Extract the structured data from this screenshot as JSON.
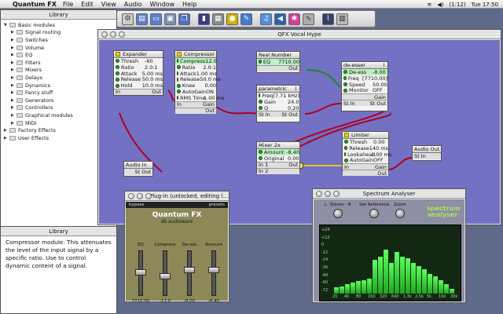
{
  "menubar": {
    "app": "Quantum FX",
    "items": [
      "File",
      "Edit",
      "View",
      "Audio",
      "Window",
      "Help"
    ],
    "battery": "(1:12)",
    "clock": "Tue 17:50"
  },
  "library": {
    "title": "Library",
    "root": "Basic modules",
    "items": [
      "Signal routing",
      "Switches",
      "Volume",
      "EQ",
      "Filters",
      "Mixers",
      "Delays",
      "Dynamics",
      "Fancy stuff",
      "Generators",
      "Controllers",
      "Graphical modules",
      "MIDI"
    ],
    "others": [
      "Factory Effects",
      "User Effects"
    ]
  },
  "description": {
    "title": "Library",
    "text": "Compressor module. This attenuates the level of the input signal by a specific ratio. Use to control dynamic content of a signal."
  },
  "graph": {
    "title": "QFX Vocal Hype",
    "expander": {
      "title": "Expander",
      "params": [
        [
          "Thresh",
          "-60"
        ],
        [
          "Ratio",
          "2.0:1"
        ],
        [
          "Attack",
          "5.00 ms"
        ],
        [
          "Release",
          "50.0 ms"
        ],
        [
          "Hold",
          "10.0 ms"
        ]
      ],
      "in": "In",
      "out": "Out"
    },
    "compressor": {
      "title": "Compressor",
      "params": [
        [
          "Compress",
          "-12.0"
        ],
        [
          "Ratio",
          "2.0:1"
        ],
        [
          "Attack",
          "1.00 ms"
        ],
        [
          "Release",
          "50.0 ms"
        ],
        [
          "Knee",
          "0.00"
        ],
        [
          "AutoGain",
          "ON"
        ],
        [
          "RMS Time",
          "1.00 ms"
        ]
      ],
      "in": "In",
      "gain": "Gain",
      "out": "Out"
    },
    "realnumber": {
      "title": "Real Number",
      "params": [
        [
          "EQ",
          "7710.00"
        ]
      ],
      "out": "Out"
    },
    "parametric": {
      "title": "parametric",
      "params": [
        [
          "Freq",
          "[7.71 kHz]"
        ],
        [
          "Gain",
          "24.0"
        ],
        [
          "Q",
          "0.20"
        ]
      ],
      "in": "St In",
      "out": "St Out"
    },
    "deesser": {
      "title": "de-esser",
      "params": [
        [
          "De-ess",
          "-8.00"
        ],
        [
          "Freq",
          "[7710.00]"
        ],
        [
          "Speed",
          "50.00"
        ],
        [
          "Monitor",
          "OFF"
        ]
      ],
      "gain": "Gain",
      "in": "St In",
      "out": "St Out"
    },
    "mixer": {
      "title": "Mixer 2x",
      "params": [
        [
          "Amount",
          "-8.40"
        ],
        [
          "Original",
          "0.00"
        ]
      ],
      "in1": "In 1",
      "in2": "In 2",
      "out": "Out"
    },
    "limiter": {
      "title": "Limiter",
      "params": [
        [
          "Thresh",
          "0.00"
        ],
        [
          "Release",
          "140 ms"
        ],
        [
          "Lookahead",
          "1.00 ms"
        ],
        [
          "AutoGain",
          "OFF"
        ]
      ],
      "in": "In",
      "gain": "Gain",
      "out": "Out"
    },
    "audioin": {
      "title": "Audio In",
      "out": "St Out"
    },
    "audioout": {
      "title": "Audio Out",
      "in": "St In"
    }
  },
  "plugin": {
    "title": "Plug-in (unlocked, editing l...",
    "bypass": "bypass",
    "presets": "presets",
    "brand": "Quantum FX",
    "brand2": "db audioware",
    "faders": [
      {
        "label": "EQ",
        "value": "7710.00",
        "level": 0.55
      },
      {
        "label": "Compress",
        "value": "-12.0",
        "level": 0.45
      },
      {
        "label": "De-ess",
        "value": "-8.00",
        "level": 0.6
      },
      {
        "label": "Amount",
        "value": "-8.40",
        "level": 0.6
      }
    ]
  },
  "spectrum": {
    "title": "Spectrum Analyser",
    "controls": [
      "L. Stereo - R",
      "Set Reference",
      "Zoom"
    ],
    "logo": "spectrum analyser",
    "ylabels": [
      "+24",
      "+12",
      "0",
      "-12",
      "-24",
      "-36",
      "-48",
      "-60",
      "-72"
    ],
    "xlabels": [
      "20",
      "40",
      "80",
      "160",
      "320",
      "640",
      "1.3k",
      "2.5k",
      "5k",
      "10k",
      "20k"
    ],
    "levels": [
      0.1,
      0.12,
      0.15,
      0.18,
      0.2,
      0.22,
      0.25,
      0.55,
      0.6,
      0.72,
      0.5,
      0.68,
      0.6,
      0.58,
      0.5,
      0.45,
      0.4,
      0.32,
      0.28,
      0.22,
      0.15,
      0.08
    ]
  }
}
